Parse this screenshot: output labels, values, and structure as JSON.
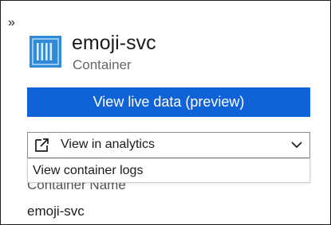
{
  "panel": {
    "collapse_glyph": "»",
    "icon": "container-icon"
  },
  "header": {
    "title": "emoji-svc",
    "subtitle": "Container"
  },
  "actions": {
    "live_data_label": "View live data (preview)",
    "analytics_dropdown": {
      "selected": "View in analytics",
      "icon": "external-link-icon",
      "options": [
        "View container logs"
      ]
    }
  },
  "fields": {
    "container_name_label": "Container Name",
    "container_name_value": "emoji-svc"
  },
  "colors": {
    "accent": "#0f63d6",
    "icon_blue": "#2f8bd8"
  }
}
